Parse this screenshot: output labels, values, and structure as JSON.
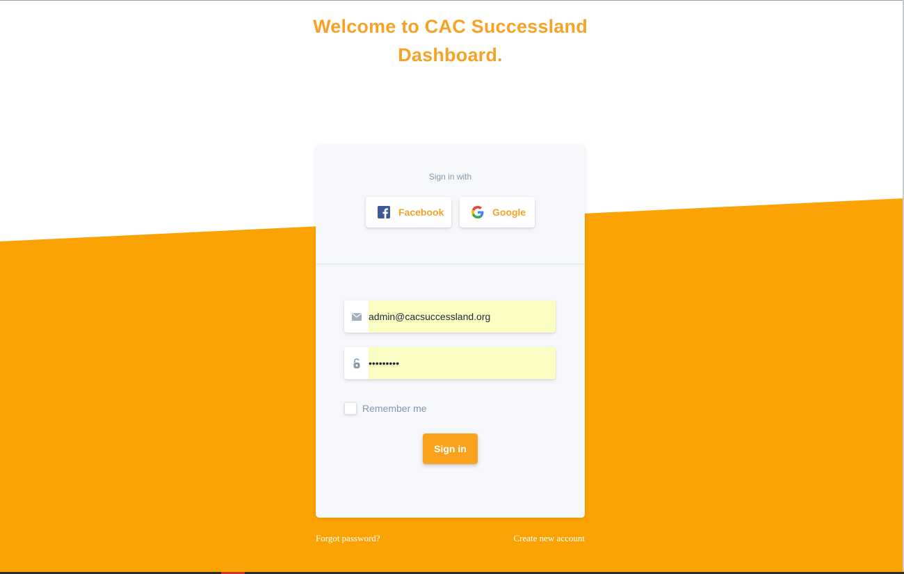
{
  "page": {
    "title": "Welcome to CAC Successland Dashboard."
  },
  "colors": {
    "accent": "#fba21d",
    "title": "#f7a227",
    "card_background": "#f5f7fa",
    "autofill_background": "#fbfdc2"
  },
  "social": {
    "heading": "Sign in with",
    "facebook_label": "Facebook",
    "google_label": "Google",
    "facebook_icon": "facebook-icon",
    "google_icon": "google-icon"
  },
  "form": {
    "email_value": "admin@cacsuccessland.org",
    "email_icon": "envelope-icon",
    "password_value": "xxxxxxxxx",
    "password_icon": "lock-icon",
    "remember_label": "Remember me",
    "remember_checked": false,
    "signin_label": "Sign in"
  },
  "footer": {
    "forgot_label": "Forgot password?",
    "create_label": "Create new account"
  }
}
